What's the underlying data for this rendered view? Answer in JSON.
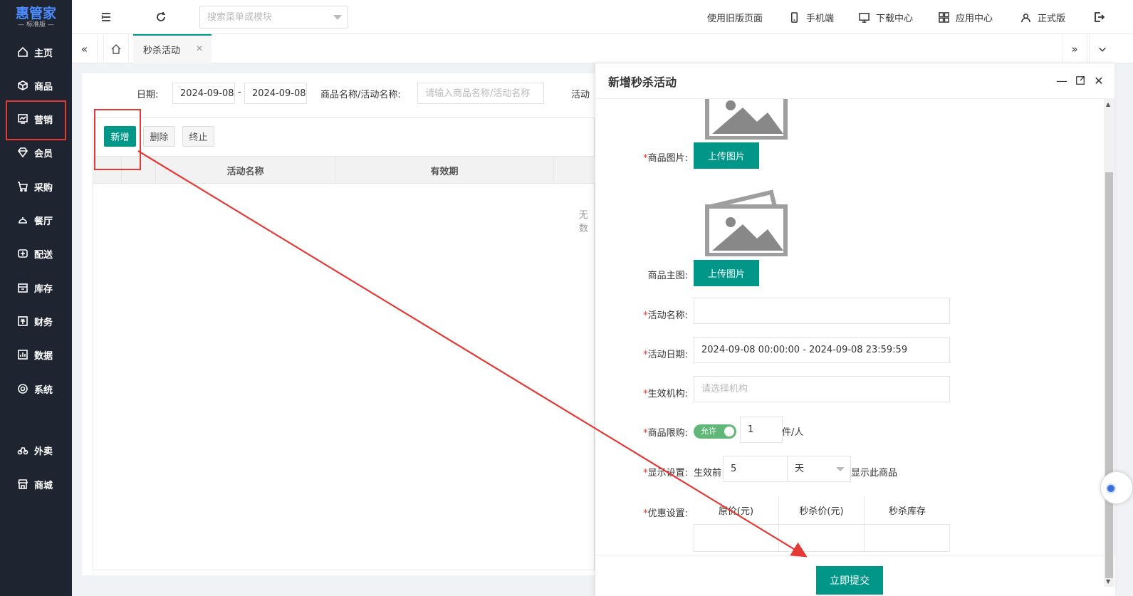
{
  "app": {
    "logo_name": "惠管家",
    "logo_edition": "— 标准版 —"
  },
  "sidebar": {
    "items": [
      {
        "label": "主页",
        "icon": "home-icon"
      },
      {
        "label": "商品",
        "icon": "box-icon"
      },
      {
        "label": "营销",
        "icon": "chart-icon"
      },
      {
        "label": "会员",
        "icon": "diamond-icon"
      },
      {
        "label": "采购",
        "icon": "cart-icon"
      },
      {
        "label": "餐厅",
        "icon": "dish-icon"
      },
      {
        "label": "配送",
        "icon": "delivery-icon"
      },
      {
        "label": "库存",
        "icon": "inventory-icon"
      },
      {
        "label": "财务",
        "icon": "finance-icon"
      },
      {
        "label": "数据",
        "icon": "data-icon"
      },
      {
        "label": "系统",
        "icon": "settings-icon"
      },
      {
        "label": "外卖",
        "icon": "bike-icon"
      },
      {
        "label": "商城",
        "icon": "store-icon"
      }
    ]
  },
  "topbar": {
    "search_placeholder": "搜索菜单或模块",
    "links": {
      "old_version": "使用旧版页面",
      "mobile": "手机端",
      "download": "下载中心",
      "apps": "应用中心",
      "edition": "正式版"
    }
  },
  "tabs": {
    "active": "秒杀活动"
  },
  "filter": {
    "date_label": "日期:",
    "date_from": "2024-09-08",
    "date_sep": "-",
    "date_to": "2024-09-08",
    "name_label": "商品名称/活动名称:",
    "name_placeholder": "请输入商品名称/活动名称",
    "activity_label_partial": "活动"
  },
  "toolbar": {
    "add": "新增",
    "delete": "删除",
    "stop": "终止"
  },
  "table": {
    "columns": [
      "活动名称",
      "有效期"
    ],
    "empty_partial": "无数"
  },
  "panel": {
    "title": "新增秒杀活动",
    "product_image_label": "商品图片:",
    "upload_label": "上传图片",
    "main_image_label": "商品主图:",
    "activity_name_label": "活动名称:",
    "activity_name_value": "",
    "activity_date_label": "活动日期:",
    "activity_date_value": "2024-09-08 00:00:00 - 2024-09-08 23:59:59",
    "org_label": "生效机构:",
    "org_placeholder": "请选择机构",
    "limit_label": "商品限购:",
    "limit_toggle": "允许",
    "limit_value": "1",
    "limit_unit": "件/人",
    "display_label": "显示设置:",
    "display_prefix": "生效前",
    "display_value": "5",
    "display_unit": "天",
    "display_suffix": "显示此商品",
    "discount_label": "优惠设置:",
    "discount_columns": [
      "原价(元)",
      "秒杀价(元)",
      "秒杀库存"
    ],
    "submit": "立即提交"
  }
}
